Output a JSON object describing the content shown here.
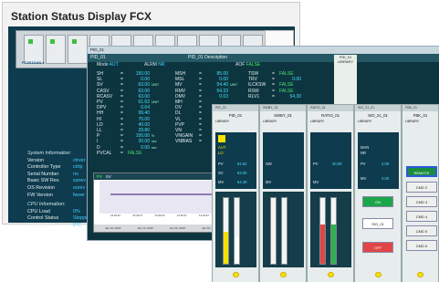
{
  "station": {
    "title": "Station Status Display FCX",
    "rack_labels": [
      "FCX01DAN ●",
      "FCX01DAN ●"
    ],
    "sys_heading": "System Information:",
    "sys": [
      {
        "k": "Version",
        "v": "ctrver"
      },
      {
        "k": "Controller Type",
        "v": "ctrtp"
      },
      {
        "k": "Serial Number",
        "v": "no"
      },
      {
        "k": "Basic SW Rev.",
        "v": "swrev"
      },
      {
        "k": "OS Revision",
        "v": "osrev"
      },
      {
        "k": "FW Version",
        "v": "fwver"
      }
    ],
    "cpu_heading": "CPU Information:",
    "cpu": [
      {
        "k": "CPU Load",
        "v": "0%"
      },
      {
        "k": "Control Status",
        "v": "Stopped"
      },
      {
        "k": "Temperature",
        "v": "0°C"
      }
    ]
  },
  "pid": {
    "window_label": "PID_01",
    "title": "PID_01 Description",
    "mode_label": "Mode",
    "mode_value": "AUT",
    "alrm_label": "ALRM",
    "alrm_value": "NR",
    "aof_label": "AOF",
    "aof_value": "FALSE",
    "lib_tag": "PID_01",
    "lib_label": "LIBRARY",
    "col1": [
      {
        "k": "SH",
        "v": "150.00"
      },
      {
        "k": "SL",
        "v": "0.00"
      },
      {
        "k": "SV",
        "v": "63.00",
        "u": "UNIT"
      },
      {
        "k": "CASV",
        "v": "63.00"
      },
      {
        "k": "RCASV",
        "v": "63.00"
      },
      {
        "k": "PV",
        "v": "61.62",
        "u": "UNIT"
      },
      {
        "k": "DPV",
        "v": "0.64"
      },
      {
        "k": "HH",
        "v": "99.40"
      },
      {
        "k": "HI",
        "v": "70.00"
      },
      {
        "k": "LO",
        "v": "40.00"
      },
      {
        "k": "LL",
        "v": "29.80"
      },
      {
        "k": "P",
        "v": "100.00",
        "u": "%"
      },
      {
        "k": "I",
        "v": "20.00",
        "u": "sec"
      },
      {
        "k": "D",
        "v": "0.00",
        "u": "sec"
      },
      {
        "k": "PVCAL",
        "v": "FALSE",
        "t": true
      }
    ],
    "col2": [
      {
        "k": "MSH",
        "v": "85.00"
      },
      {
        "k": "MSL",
        "v": "0.00"
      },
      {
        "k": "MV",
        "v": "54.40",
        "u": "UNIT"
      },
      {
        "k": "RMV",
        "v": "54.33"
      },
      {
        "k": "DMV",
        "v": "0.03"
      },
      {
        "k": "MH",
        "v": ""
      },
      {
        "k": "DV",
        "v": ""
      },
      {
        "k": "DL",
        "v": ""
      },
      {
        "k": "VL",
        "v": ""
      },
      {
        "k": "PVP",
        "v": ""
      },
      {
        "k": "VN",
        "v": ""
      },
      {
        "k": "VNGAIN",
        "v": ""
      },
      {
        "k": "VNBIAS",
        "v": ""
      }
    ],
    "col3": [
      {
        "k": "TSW",
        "v": "FALSE",
        "t": true
      },
      {
        "k": "TRV",
        "v": "0.00"
      },
      {
        "k": "ILCKSW",
        "v": "FALSE",
        "t": true
      },
      {
        "k": "RSW",
        "v": "FALSE",
        "t": true
      },
      {
        "k": "RLV1",
        "v": "54.30"
      }
    ]
  },
  "trend": {
    "pv_label": "PV",
    "sv_label": "SV",
    "ticks": [
      "14:46:22",
      "14:46:27",
      "14:46:32",
      "14:46:37",
      "14:46:42",
      "14:46:47",
      "14:46:52",
      "14:46:57",
      "14:47:02"
    ],
    "foot": [
      "Jan 10, 2015",
      "Jan 10, 2015",
      "Jan 10, 2015",
      "Jan 10, 2015"
    ]
  },
  "faceplates": [
    {
      "header": "PID_01",
      "tag": "PID_01",
      "lib": "LIBRARY",
      "mode": "AUT",
      "alarm": "LO",
      "pv": "61.62",
      "sv": "63.00",
      "mv": "54.40",
      "units": "UNIT"
    },
    {
      "header": "SWBY_01",
      "tag": "SWBY_01",
      "lib": "LIBRARY",
      "pv": "20.00",
      "sv": "SW",
      "mv": ""
    },
    {
      "header": "RATIO_01",
      "tag": "RATIO_01",
      "lib": "LIBRARY",
      "pv": "20.00",
      "sv": "",
      "mv": ""
    },
    {
      "header": "SIO_21_01",
      "tag": "SIO_21_01",
      "lib": "LIBRARY",
      "mode": "MAN",
      "alarm": "NR",
      "pv": "2.00",
      "mv": "2.00",
      "on_label": "ON",
      "mid_label": "SIO_21",
      "off_label": "OFF"
    },
    {
      "header": "FBK_01",
      "tag": "FBK_01",
      "lib": "LIBRARY",
      "active": "REMOTE",
      "cmds": [
        "CMD 2",
        "CMD 3",
        "CMD 4",
        "CMD 5",
        "CMD 6"
      ]
    }
  ],
  "colors": {
    "accent": "#46e0ff",
    "panel": "#0e3b4d",
    "ok": "#4be06b",
    "alarm_yellow": "#ffe100"
  }
}
